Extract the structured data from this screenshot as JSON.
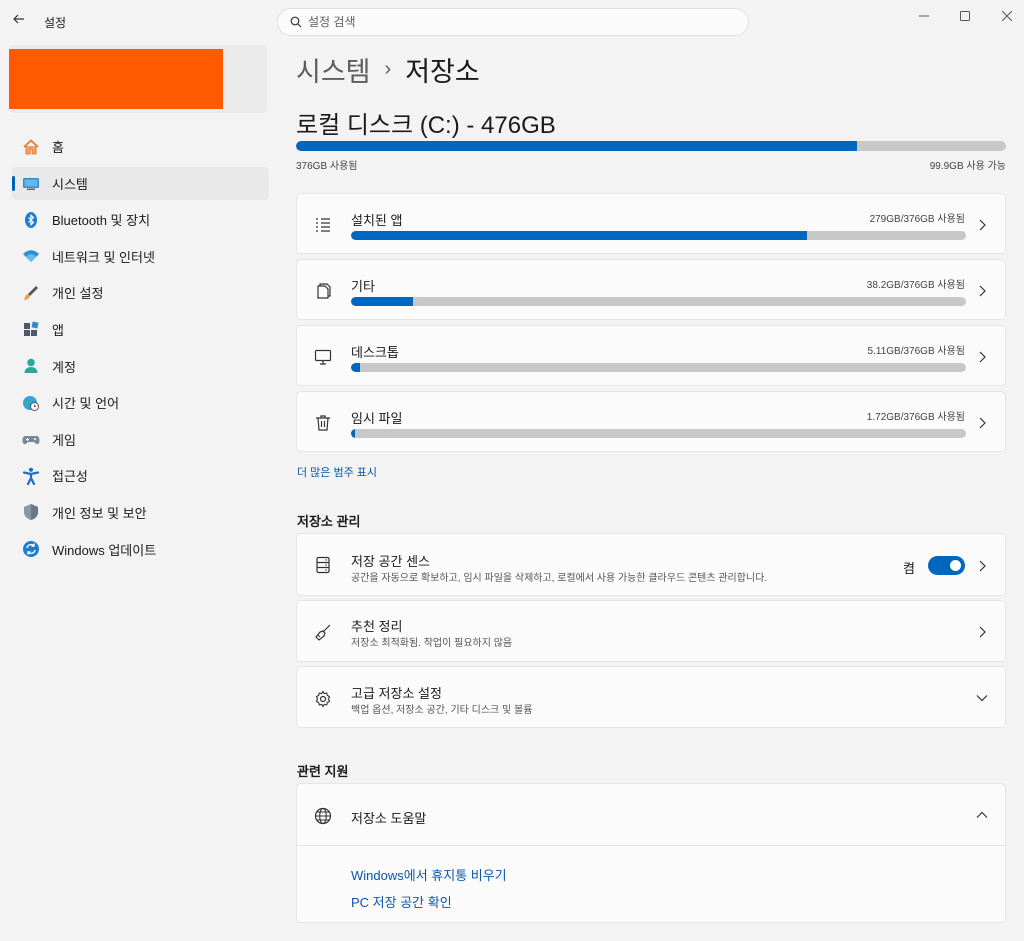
{
  "window": {
    "app_title": "설정",
    "search_placeholder": "설정 검색"
  },
  "sidebar": {
    "items": [
      {
        "label": "홈",
        "icon": "home-icon"
      },
      {
        "label": "시스템",
        "icon": "system-icon",
        "active": true
      },
      {
        "label": "Bluetooth 및 장치",
        "icon": "bluetooth-icon"
      },
      {
        "label": "네트워크 및 인터넷",
        "icon": "wifi-icon"
      },
      {
        "label": "개인 설정",
        "icon": "brush-icon"
      },
      {
        "label": "앱",
        "icon": "apps-icon"
      },
      {
        "label": "계정",
        "icon": "account-icon"
      },
      {
        "label": "시간 및 언어",
        "icon": "globe-clock-icon"
      },
      {
        "label": "게임",
        "icon": "gamepad-icon"
      },
      {
        "label": "접근성",
        "icon": "accessibility-icon"
      },
      {
        "label": "개인 정보 및 보안",
        "icon": "shield-icon"
      },
      {
        "label": "Windows 업데이트",
        "icon": "update-icon"
      }
    ]
  },
  "breadcrumb": {
    "parent": "시스템",
    "separator": "›",
    "current": "저장소"
  },
  "disk": {
    "title": "로컬 디스크 (C:) - 476GB",
    "used_label": "376GB 사용됨",
    "free_label": "99.9GB 사용 가능",
    "used_fraction": 0.79
  },
  "categories": [
    {
      "label": "설치된 앱",
      "usage": "279GB/376GB 사용됨",
      "fraction": 0.742,
      "icon": "list-icon"
    },
    {
      "label": "기타",
      "usage": "38.2GB/376GB 사용됨",
      "fraction": 0.101,
      "icon": "document-icon"
    },
    {
      "label": "데스크톱",
      "usage": "5.11GB/376GB 사용됨",
      "fraction": 0.014,
      "icon": "monitor-icon"
    },
    {
      "label": "임시 파일",
      "usage": "1.72GB/376GB 사용됨",
      "fraction": 0.005,
      "icon": "trash-icon"
    }
  ],
  "more_categories_link": "더 많은 범주 표시",
  "management": {
    "title": "저장소 관리",
    "storage_sense": {
      "title": "저장 공간 센스",
      "description": "공간을 자동으로 확보하고, 임시 파일을 삭제하고, 로컬에서 사용 가능한 클라우드 콘텐츠 관리합니다.",
      "toggle_label": "켬",
      "toggle_on": true
    },
    "cleanup": {
      "title": "추천 정리",
      "description": "저장소 최적화됨. 작업이 필요하지 않음"
    },
    "advanced": {
      "title": "고급 저장소 설정",
      "description": "백업 옵션, 저장소 공간, 기타 디스크 및 볼륨"
    }
  },
  "related": {
    "title": "관련 지원",
    "help_title": "저장소 도움말",
    "links": [
      "Windows에서 휴지통 비우기",
      "PC 저장 공간 확인"
    ]
  },
  "colors": {
    "accent": "#0067c0",
    "bar_track": "#c8c8c8",
    "profile_block": "#ff5a00"
  }
}
